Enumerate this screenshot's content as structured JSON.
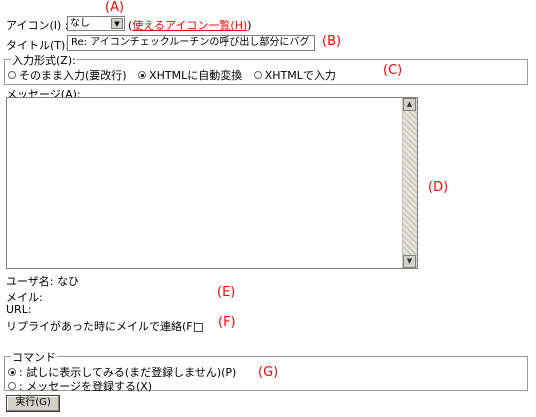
{
  "annotations": {
    "a": "(A)",
    "b": "(B)",
    "c": "(C)",
    "d": "(D)",
    "e": "(E)",
    "f": "(F)",
    "g": "(G)"
  },
  "icon_row": {
    "label": "アイコン(I) :",
    "select_value": "なし",
    "link_open": "(",
    "link_text": "使えるアイコン一覧(H)",
    "link_close": ")"
  },
  "title_row": {
    "label": "タイトル(T):",
    "value": "Re: アイコンチェックルーチンの呼び出し部分にバグ"
  },
  "input_format": {
    "legend": "入力形式(Z):",
    "options": [
      {
        "label": "そのまま入力(要改行)",
        "checked": false
      },
      {
        "label": "XHTMLに自動変換",
        "checked": true
      },
      {
        "label": "XHTMLで入力",
        "checked": false
      }
    ]
  },
  "message": {
    "label": "メッセージ(A):",
    "value": ""
  },
  "user_info": {
    "username": "ユーザ名: なひ",
    "mail_label": "メイル:",
    "url_label": "URL:",
    "notify_label": "リプライがあった時にメイルで連絡(F):"
  },
  "command": {
    "legend": "コマンド",
    "options": [
      {
        "label": ": 試しに表示してみる(まだ登録しません)(P)",
        "checked": true
      },
      {
        "label": ": メッセージを登録する(X)",
        "checked": false
      }
    ]
  },
  "execute_button": "実行(G)",
  "colors": {
    "annotation": "#ff0000",
    "link": "#ff0000"
  }
}
